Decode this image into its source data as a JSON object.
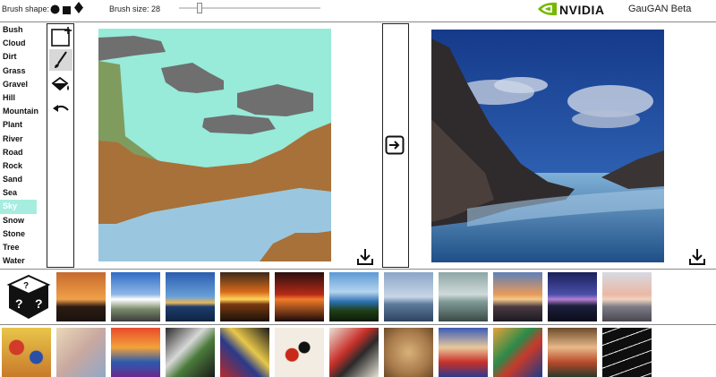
{
  "toolbar": {
    "brush_shape_label": "Brush shape:",
    "brush_size_label": "Brush size: 28",
    "brush_size_value": 28,
    "brush_shapes": [
      "circle",
      "square",
      "diamond"
    ]
  },
  "brand": {
    "logo_text": "NVIDIA",
    "app_title": "GauGAN Beta",
    "accent": "#76b900"
  },
  "labels": {
    "items": [
      "Bush",
      "Cloud",
      "Dirt",
      "Grass",
      "Gravel",
      "Hill",
      "Mountain",
      "Plant",
      "River",
      "Road",
      "Rock",
      "Sand",
      "Sea",
      "Sky",
      "Snow",
      "Stone",
      "Tree",
      "Water"
    ],
    "selected": "Sky",
    "selected_color": "#a6ede0"
  },
  "tools": [
    "new-canvas-icon",
    "brush-icon",
    "paint-bucket-icon",
    "undo-icon"
  ],
  "segmentation_colors": {
    "sky": "#98ead9",
    "cloud": "#6f6f6f",
    "hill": "#7f9c5e",
    "dirt": "#a8713a",
    "water": "#9ac7df"
  },
  "icons": {
    "render": "arrow-right-icon",
    "download": "download-icon",
    "random": "random-dice-icon"
  }
}
